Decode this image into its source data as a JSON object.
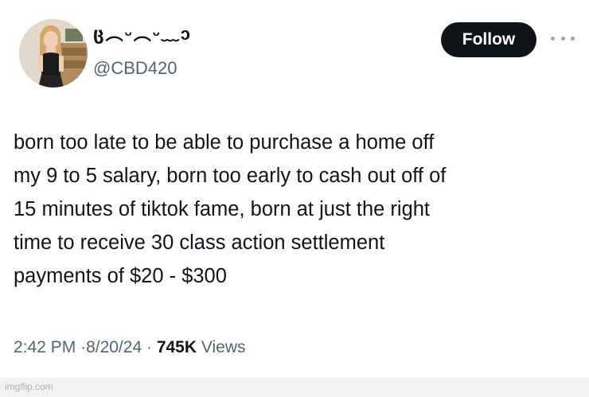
{
  "user": {
    "display_name": "ც︵ᵕ︵ᵕ﹏ↄ",
    "handle": "@CBD420",
    "avatar_icon": "profile-photo"
  },
  "actions": {
    "follow_label": "Follow",
    "more_icon": "ellipsis-icon"
  },
  "tweet": {
    "text": "born too late to be able to purchase a home off\nmy 9 to 5 salary, born too early to cash out off of\n15 minutes of tiktok fame, born at just the right\ntime to receive 30 class action settlement\npayments of $20 - $300"
  },
  "meta": {
    "time": "2:42 PM",
    "separator": "·",
    "date": "8/20/24",
    "views_count": "745K",
    "views_label": "Views"
  },
  "watermark": "imgflip.com",
  "colors": {
    "text_primary": "#0f1419",
    "text_secondary": "#536471",
    "button_bg": "#0f1419",
    "button_text": "#ffffff"
  }
}
